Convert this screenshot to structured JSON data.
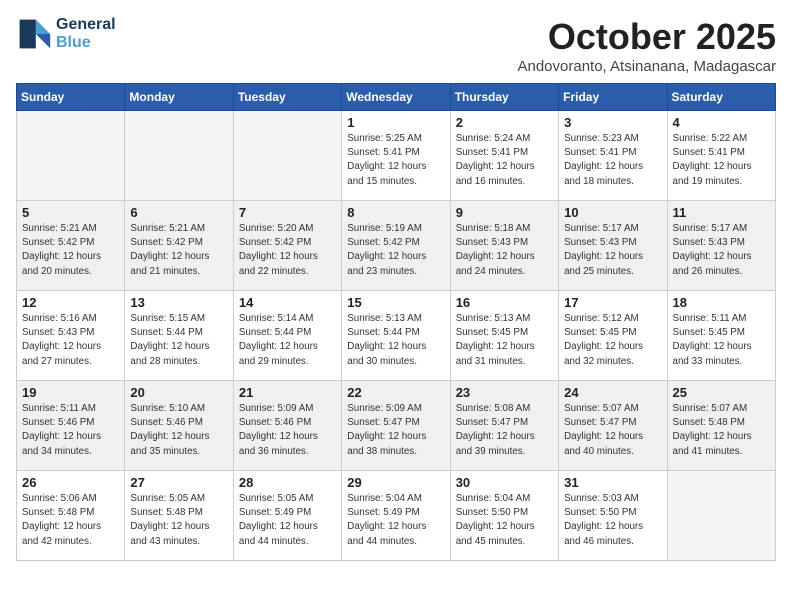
{
  "logo": {
    "line1": "General",
    "line2": "Blue"
  },
  "title": "October 2025",
  "location": "Andovoranto, Atsinanana, Madagascar",
  "days_header": [
    "Sunday",
    "Monday",
    "Tuesday",
    "Wednesday",
    "Thursday",
    "Friday",
    "Saturday"
  ],
  "weeks": [
    [
      {
        "num": "",
        "info": ""
      },
      {
        "num": "",
        "info": ""
      },
      {
        "num": "",
        "info": ""
      },
      {
        "num": "1",
        "info": "Sunrise: 5:25 AM\nSunset: 5:41 PM\nDaylight: 12 hours\nand 15 minutes."
      },
      {
        "num": "2",
        "info": "Sunrise: 5:24 AM\nSunset: 5:41 PM\nDaylight: 12 hours\nand 16 minutes."
      },
      {
        "num": "3",
        "info": "Sunrise: 5:23 AM\nSunset: 5:41 PM\nDaylight: 12 hours\nand 18 minutes."
      },
      {
        "num": "4",
        "info": "Sunrise: 5:22 AM\nSunset: 5:41 PM\nDaylight: 12 hours\nand 19 minutes."
      }
    ],
    [
      {
        "num": "5",
        "info": "Sunrise: 5:21 AM\nSunset: 5:42 PM\nDaylight: 12 hours\nand 20 minutes."
      },
      {
        "num": "6",
        "info": "Sunrise: 5:21 AM\nSunset: 5:42 PM\nDaylight: 12 hours\nand 21 minutes."
      },
      {
        "num": "7",
        "info": "Sunrise: 5:20 AM\nSunset: 5:42 PM\nDaylight: 12 hours\nand 22 minutes."
      },
      {
        "num": "8",
        "info": "Sunrise: 5:19 AM\nSunset: 5:42 PM\nDaylight: 12 hours\nand 23 minutes."
      },
      {
        "num": "9",
        "info": "Sunrise: 5:18 AM\nSunset: 5:43 PM\nDaylight: 12 hours\nand 24 minutes."
      },
      {
        "num": "10",
        "info": "Sunrise: 5:17 AM\nSunset: 5:43 PM\nDaylight: 12 hours\nand 25 minutes."
      },
      {
        "num": "11",
        "info": "Sunrise: 5:17 AM\nSunset: 5:43 PM\nDaylight: 12 hours\nand 26 minutes."
      }
    ],
    [
      {
        "num": "12",
        "info": "Sunrise: 5:16 AM\nSunset: 5:43 PM\nDaylight: 12 hours\nand 27 minutes."
      },
      {
        "num": "13",
        "info": "Sunrise: 5:15 AM\nSunset: 5:44 PM\nDaylight: 12 hours\nand 28 minutes."
      },
      {
        "num": "14",
        "info": "Sunrise: 5:14 AM\nSunset: 5:44 PM\nDaylight: 12 hours\nand 29 minutes."
      },
      {
        "num": "15",
        "info": "Sunrise: 5:13 AM\nSunset: 5:44 PM\nDaylight: 12 hours\nand 30 minutes."
      },
      {
        "num": "16",
        "info": "Sunrise: 5:13 AM\nSunset: 5:45 PM\nDaylight: 12 hours\nand 31 minutes."
      },
      {
        "num": "17",
        "info": "Sunrise: 5:12 AM\nSunset: 5:45 PM\nDaylight: 12 hours\nand 32 minutes."
      },
      {
        "num": "18",
        "info": "Sunrise: 5:11 AM\nSunset: 5:45 PM\nDaylight: 12 hours\nand 33 minutes."
      }
    ],
    [
      {
        "num": "19",
        "info": "Sunrise: 5:11 AM\nSunset: 5:46 PM\nDaylight: 12 hours\nand 34 minutes."
      },
      {
        "num": "20",
        "info": "Sunrise: 5:10 AM\nSunset: 5:46 PM\nDaylight: 12 hours\nand 35 minutes."
      },
      {
        "num": "21",
        "info": "Sunrise: 5:09 AM\nSunset: 5:46 PM\nDaylight: 12 hours\nand 36 minutes."
      },
      {
        "num": "22",
        "info": "Sunrise: 5:09 AM\nSunset: 5:47 PM\nDaylight: 12 hours\nand 38 minutes."
      },
      {
        "num": "23",
        "info": "Sunrise: 5:08 AM\nSunset: 5:47 PM\nDaylight: 12 hours\nand 39 minutes."
      },
      {
        "num": "24",
        "info": "Sunrise: 5:07 AM\nSunset: 5:47 PM\nDaylight: 12 hours\nand 40 minutes."
      },
      {
        "num": "25",
        "info": "Sunrise: 5:07 AM\nSunset: 5:48 PM\nDaylight: 12 hours\nand 41 minutes."
      }
    ],
    [
      {
        "num": "26",
        "info": "Sunrise: 5:06 AM\nSunset: 5:48 PM\nDaylight: 12 hours\nand 42 minutes."
      },
      {
        "num": "27",
        "info": "Sunrise: 5:05 AM\nSunset: 5:48 PM\nDaylight: 12 hours\nand 43 minutes."
      },
      {
        "num": "28",
        "info": "Sunrise: 5:05 AM\nSunset: 5:49 PM\nDaylight: 12 hours\nand 44 minutes."
      },
      {
        "num": "29",
        "info": "Sunrise: 5:04 AM\nSunset: 5:49 PM\nDaylight: 12 hours\nand 44 minutes."
      },
      {
        "num": "30",
        "info": "Sunrise: 5:04 AM\nSunset: 5:50 PM\nDaylight: 12 hours\nand 45 minutes."
      },
      {
        "num": "31",
        "info": "Sunrise: 5:03 AM\nSunset: 5:50 PM\nDaylight: 12 hours\nand 46 minutes."
      },
      {
        "num": "",
        "info": ""
      }
    ]
  ]
}
